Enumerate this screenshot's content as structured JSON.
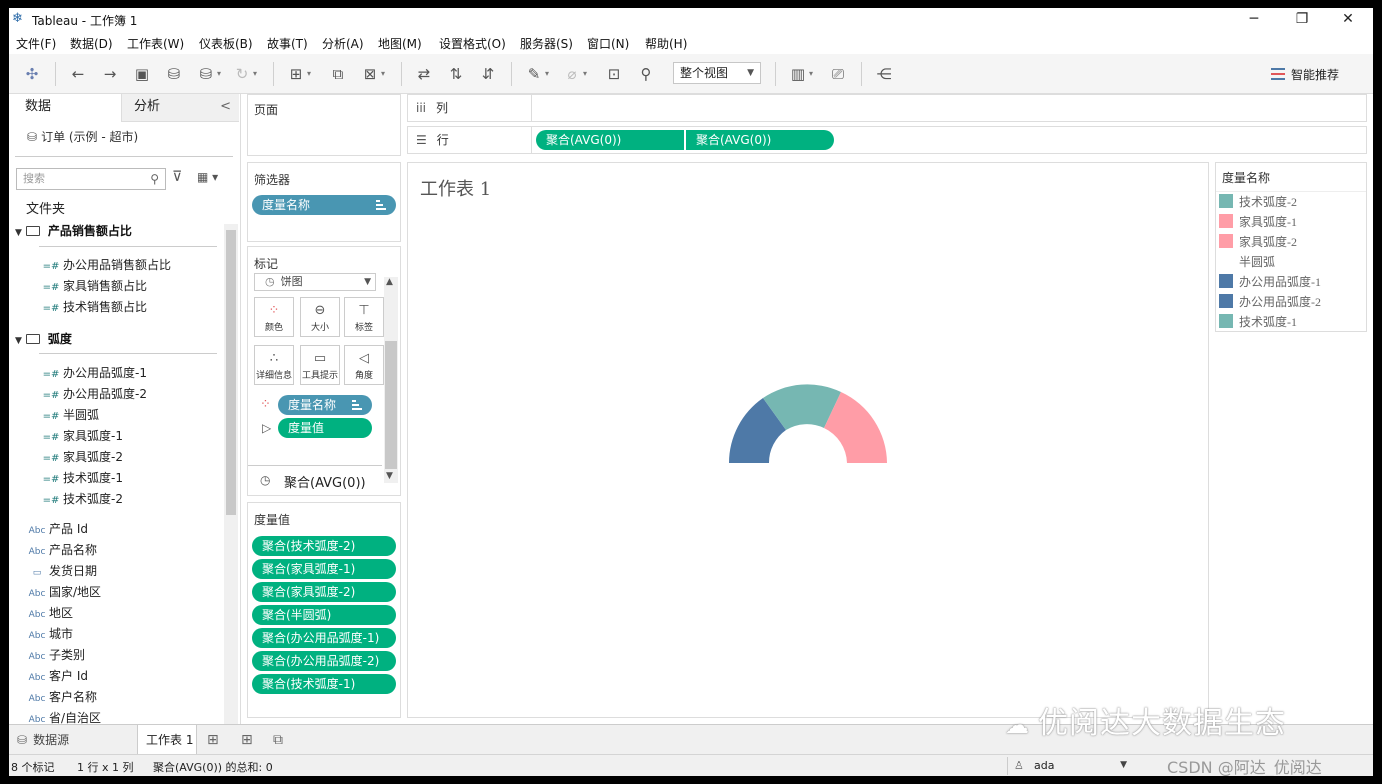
{
  "window": {
    "title": "Tableau - 工作簿 1",
    "minimize": "─",
    "maximize": "❐",
    "close": "✕"
  },
  "menu": [
    "文件(F)",
    "数据(D)",
    "工作表(W)",
    "仪表板(B)",
    "故事(T)",
    "分析(A)",
    "地图(M)",
    "设置格式(O)",
    "服务器(S)",
    "窗口(N)",
    "帮助(H)"
  ],
  "toolbar": {
    "fit_view": "整个视图",
    "smart": "智能推荐"
  },
  "data_pane": {
    "tab_data": "数据",
    "tab_analysis": "分析",
    "collapse": "<",
    "datasource": "订单 (示例 - 超市)",
    "search_placeholder": "搜索",
    "folders_label": "文件夹",
    "group1": {
      "name": "产品销售额占比",
      "fields": [
        "办公用品销售额占比",
        "家具销售额占比",
        "技术销售额占比"
      ]
    },
    "group2": {
      "name": "弧度",
      "fields": [
        "办公用品弧度-1",
        "办公用品弧度-2",
        "半圆弧",
        "家具弧度-1",
        "家具弧度-2",
        "技术弧度-1",
        "技术弧度-2"
      ]
    },
    "dim_prefix": "Abc",
    "dimensions": [
      "产品 Id",
      "产品名称",
      "发货日期",
      "国家/地区",
      "地区",
      "城市",
      "子类别",
      "客户 Id",
      "客户名称",
      "省/自治区"
    ]
  },
  "pages_card": {
    "title": "页面"
  },
  "filters_card": {
    "title": "筛选器",
    "pill": "度量名称"
  },
  "marks_card": {
    "title": "标记",
    "type": "饼图",
    "buttons": [
      "颜色",
      "大小",
      "标签",
      "详细信息",
      "工具提示",
      "角度"
    ],
    "pill_color": "度量名称",
    "pill_angle": "度量值",
    "agg_row": "聚合(AVG(0))"
  },
  "measure_values_card": {
    "title": "度量值",
    "pills": [
      "聚合(技术弧度-2)",
      "聚合(家具弧度-1)",
      "聚合(家具弧度-2)",
      "聚合(半圆弧)",
      "聚合(办公用品弧度-1)",
      "聚合(办公用品弧度-2)",
      "聚合(技术弧度-1)"
    ]
  },
  "columns_shelf": {
    "label": "列"
  },
  "rows_shelf": {
    "label": "行",
    "pills": [
      "聚合(AVG(0))",
      "聚合(AVG(0))"
    ]
  },
  "sheet_title": "工作表 1",
  "legend": {
    "title": "度量名称",
    "items": [
      {
        "label": "技术弧度-2",
        "color": "#76b7b2"
      },
      {
        "label": "家具弧度-1",
        "color": "#ff9da7"
      },
      {
        "label": "家具弧度-2",
        "color": "#ff9da7"
      },
      {
        "label": "半圆弧",
        "color": "#ffffff"
      },
      {
        "label": "办公用品弧度-1",
        "color": "#4e79a7"
      },
      {
        "label": "办公用品弧度-2",
        "color": "#4e79a7"
      },
      {
        "label": "技术弧度-1",
        "color": "#76b7b2"
      }
    ]
  },
  "bottom_tabs": {
    "datasource": "数据源",
    "sheet": "工作表 1"
  },
  "status": {
    "marks": "8 个标记",
    "rows_cols": "1 行 x 1 列",
    "sum": "聚合(AVG(0)) 的总和: 0",
    "user": "ada"
  },
  "watermark": "优阅达大数据生态",
  "csdn": "CSDN @阿达_优阅达"
}
